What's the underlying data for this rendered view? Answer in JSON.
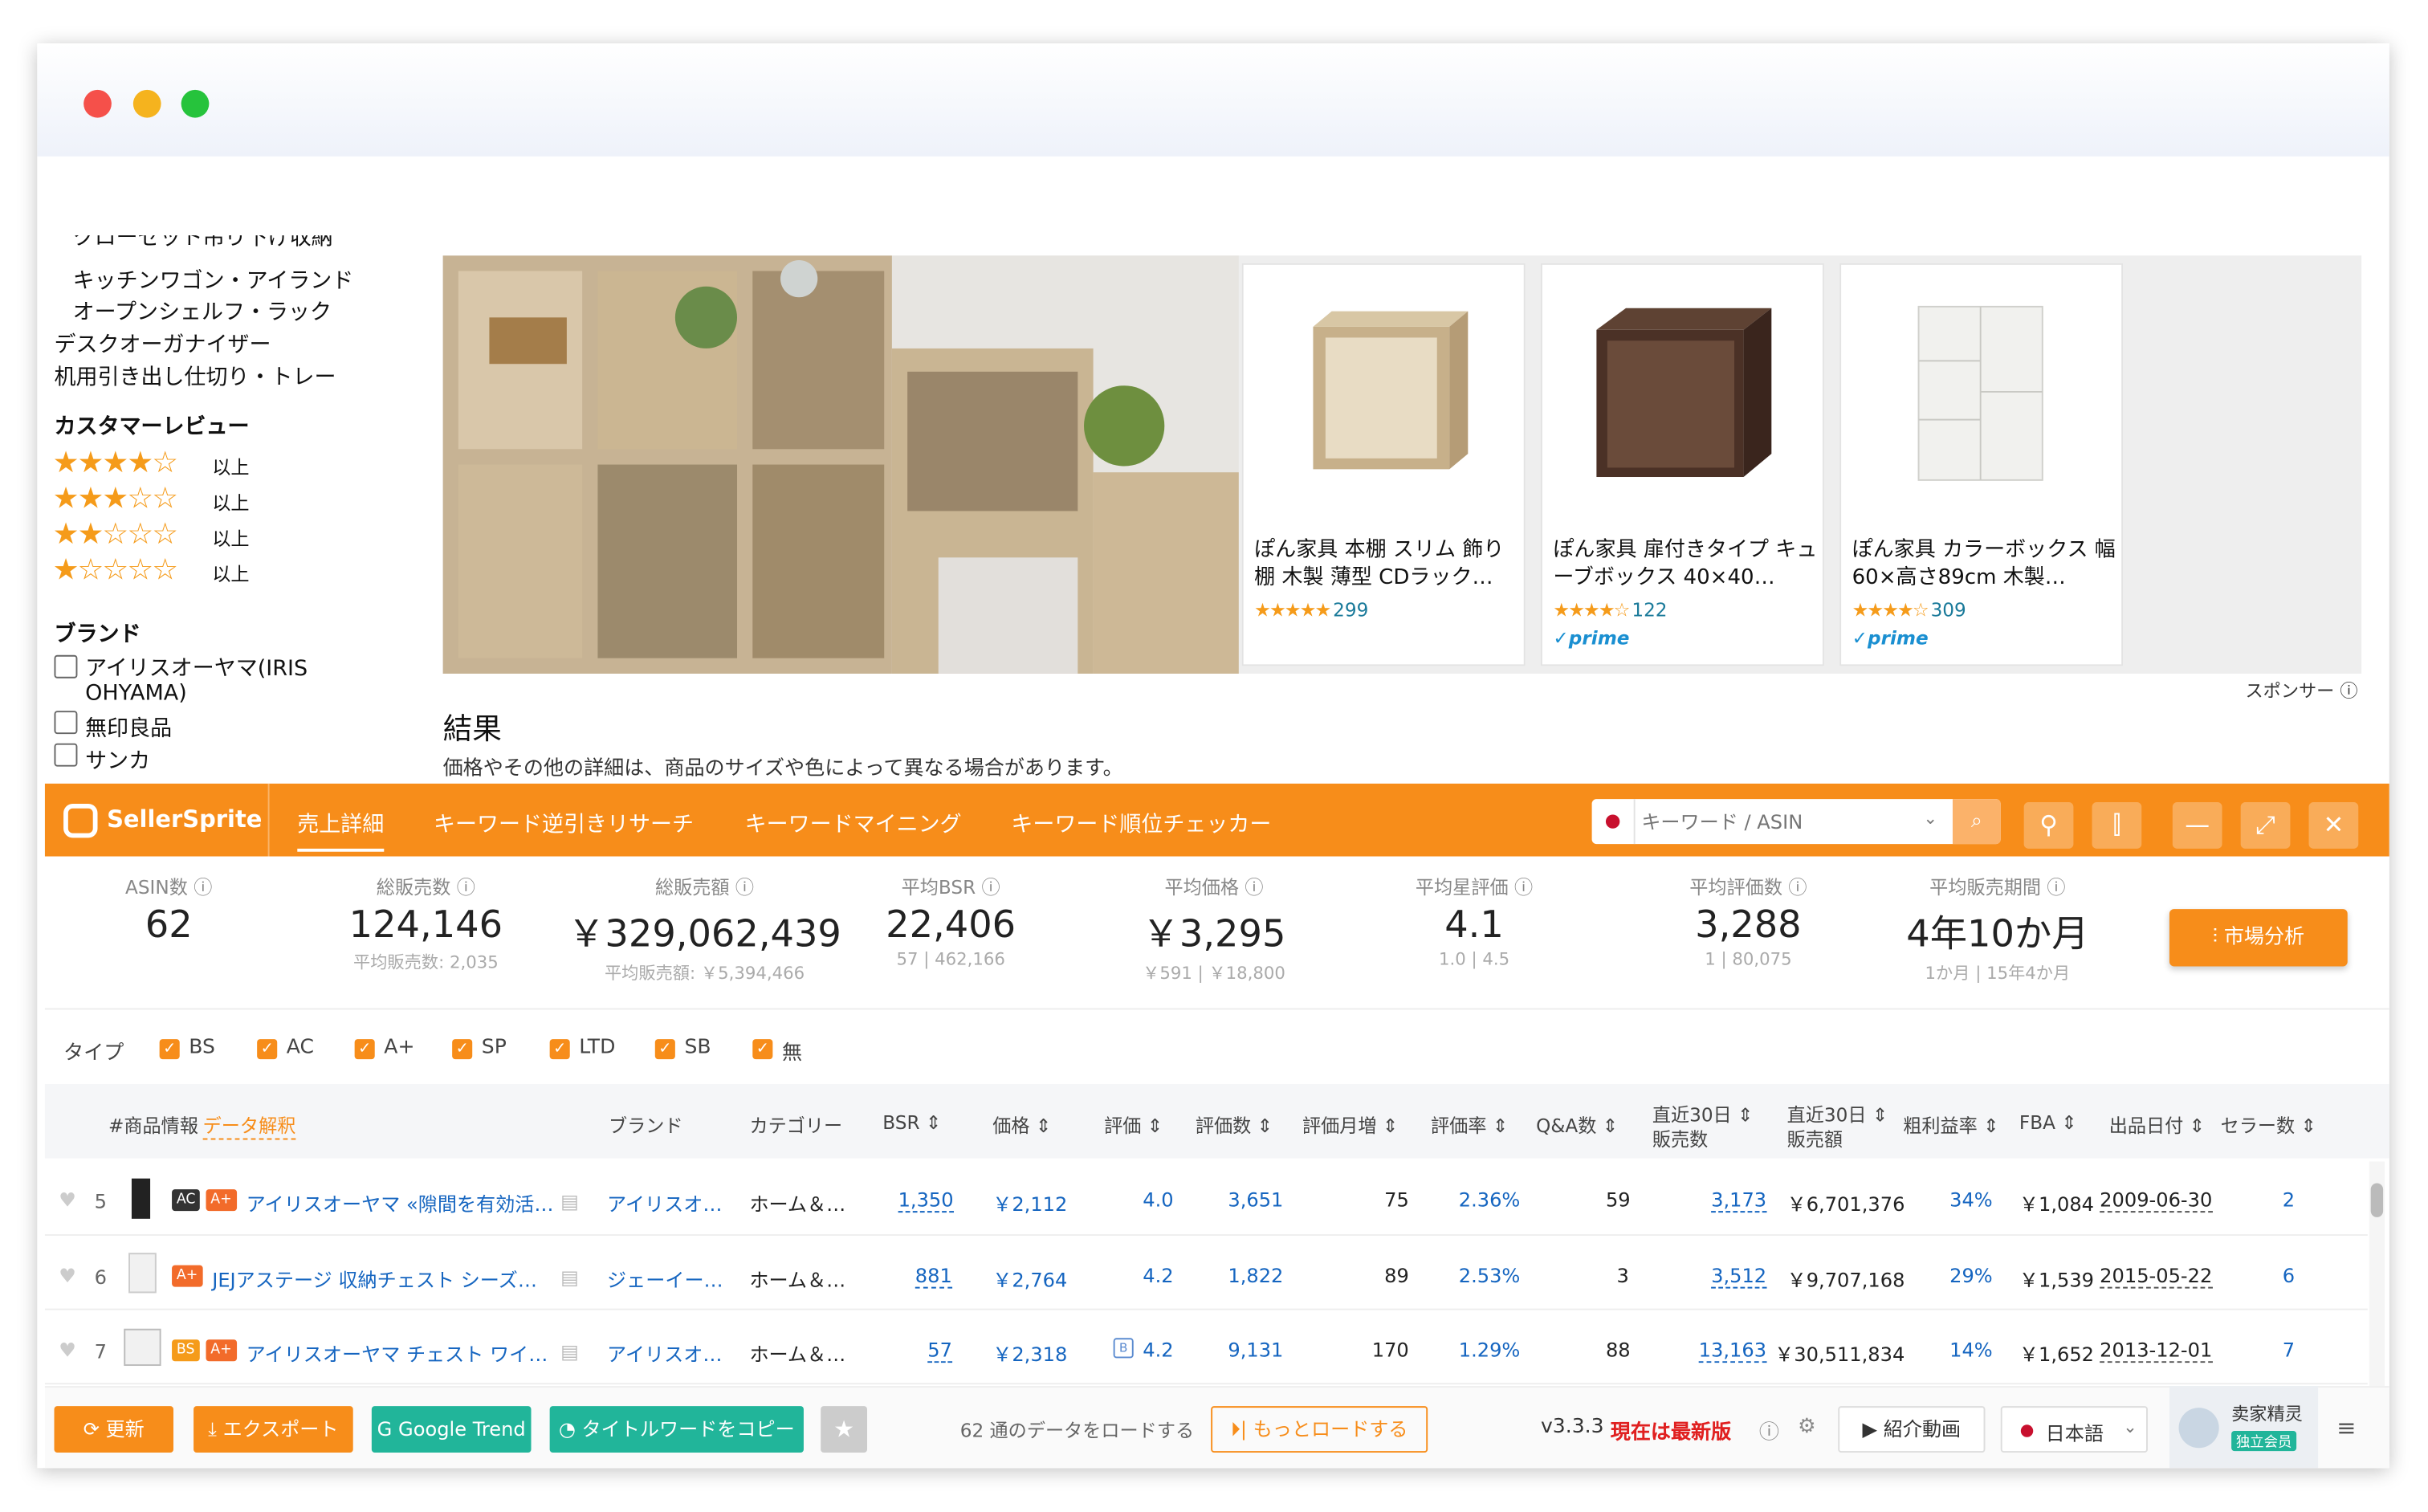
{
  "sidebar": {
    "cut_item": "クローゼット吊り下げ収納",
    "categories": [
      "キッチンワゴン・アイランド",
      "オープンシェルフ・ラック",
      "デスクオーガナイザー",
      "机用引き出し仕切り・トレー"
    ],
    "review_heading": "カスタマーレビュー",
    "review_rows": [
      {
        "stars": "★★★★☆",
        "label": "以上"
      },
      {
        "stars": "★★★☆☆",
        "label": "以上"
      },
      {
        "stars": "★★☆☆☆",
        "label": "以上"
      },
      {
        "stars": "★☆☆☆☆",
        "label": "以上"
      }
    ],
    "brand_heading": "ブランド",
    "brands": [
      "アイリスオーヤマ(IRIS OHYAMA)",
      "無印良品",
      "サンカ"
    ]
  },
  "sponsored": {
    "products": [
      {
        "title": "ぽん家具 本棚 スリム 飾り棚 木製 薄型 CDラック…",
        "stars": "★★★★★",
        "count": "299",
        "prime": ""
      },
      {
        "title": "ぽん家具 扉付きタイプ キューブボックス 40×40…",
        "stars": "★★★★☆",
        "count": "122",
        "prime": "✓prime"
      },
      {
        "title": "ぽん家具 カラーボックス 幅60×高さ89cm 木製…",
        "stars": "★★★★☆",
        "count": "309",
        "prime": "✓prime"
      }
    ],
    "sponsor_label": "スポンサー ⓘ"
  },
  "results": {
    "heading": "結果",
    "note": "価格やその他の詳細は、商品のサイズや色によって異なる場合があります。"
  },
  "toolbar": {
    "brand": "SellerSprite",
    "tabs": [
      "売上詳細",
      "キーワード逆引きリサーチ",
      "キーワードマイニング",
      "キーワード順位チェッカー"
    ],
    "search_placeholder": "キーワード / ASIN"
  },
  "stats": [
    {
      "label": "ASIN数 ⓘ",
      "value": "62",
      "sub": ""
    },
    {
      "label": "総販売数 ⓘ",
      "value": "124,146",
      "sub": "平均販売数: 2,035"
    },
    {
      "label": "総販売額 ⓘ",
      "value": "￥329,062,439",
      "sub": "平均販売額: ￥5,394,466"
    },
    {
      "label": "平均BSR ⓘ",
      "value": "22,406",
      "sub": "57 | 462,166"
    },
    {
      "label": "平均価格 ⓘ",
      "value": "￥3,295",
      "sub": "￥591 | ￥18,800"
    },
    {
      "label": "平均星評価 ⓘ",
      "value": "4.1",
      "sub": "1.0 | 4.5"
    },
    {
      "label": "平均評価数 ⓘ",
      "value": "3,288",
      "sub": "1 | 80,075"
    },
    {
      "label": "平均販売期間 ⓘ",
      "value": "4年10か月",
      "sub": "1か月 | 15年4か月"
    }
  ],
  "market_button": "市場分析",
  "types": {
    "label": "タイプ",
    "items": [
      "BS",
      "AC",
      "A+",
      "SP",
      "LTD",
      "SB",
      "無"
    ]
  },
  "headers": {
    "product": "#商品情報",
    "data_link": "データ解釈",
    "brand": "ブランド",
    "category": "カテゴリー",
    "bsr": "BSR ⇕",
    "price": "価格 ⇕",
    "rating": "評価 ⇕",
    "reviews": "評価数 ⇕",
    "monthly_reviews": "評価月増 ⇕",
    "rating_rate": "評価率 ⇕",
    "qa": "Q&A数 ⇕",
    "sales30_1": "直近30日 ⇕",
    "sales30_2": "販売数",
    "rev30_1": "直近30日 ⇕",
    "rev30_2": "販売額",
    "margin": "粗利益率 ⇕",
    "fba": "FBA ⇕",
    "date": "出品日付 ⇕",
    "sellers": "セラー数 ⇕"
  },
  "rows": [
    {
      "num": "5",
      "badges": [
        "AC",
        "A+"
      ],
      "title": "アイリスオーヤマ «隙間を有効活…",
      "brand": "アイリスオ…",
      "category": "ホーム＆…",
      "bsr": "1,350",
      "price": "￥2,112",
      "rating": "4.0",
      "reviews": "3,651",
      "monthly": "75",
      "rate": "2.36%",
      "qa": "59",
      "sales": "3,173",
      "revenue": "￥6,701,376",
      "margin": "34%",
      "fba": "￥1,084",
      "date": "2009-06-30",
      "sellers": "2"
    },
    {
      "num": "6",
      "badges": [
        "A+"
      ],
      "title": "JEJアステージ 収納チェスト シーズ…",
      "brand": "ジェーイー…",
      "category": "ホーム＆…",
      "bsr": "881",
      "price": "￥2,764",
      "rating": "4.2",
      "reviews": "1,822",
      "monthly": "89",
      "rate": "2.53%",
      "qa": "3",
      "sales": "3,512",
      "revenue": "￥9,707,168",
      "margin": "29%",
      "fba": "￥1,539",
      "date": "2015-05-22",
      "sellers": "6"
    },
    {
      "num": "7",
      "badges": [
        "BS",
        "A+"
      ],
      "title": "アイリスオーヤマ チェスト ワイ…",
      "brand": "アイリスオ…",
      "category": "ホーム＆…",
      "bsr": "57",
      "price": "￥2,318",
      "rating": "4.2",
      "reviews": "9,131",
      "monthly": "170",
      "rate": "1.29%",
      "qa": "88",
      "sales": "13,163",
      "revenue": "￥30,511,834",
      "margin": "14%",
      "fba": "￥1,652",
      "date": "2013-12-01",
      "sellers": "7"
    }
  ],
  "footer": {
    "refresh": "⟳ 更新",
    "export": "⤓ エクスポート",
    "google": "G Google Trend",
    "copy": "◔ タイトルワードをコピー",
    "loaded": "62 通のデータをロードする",
    "load_more": "⏵| もっとロードする",
    "version": "v3.3.3",
    "latest": "現在は最新版",
    "video": "▶ 紹介動画",
    "lang": "日本語",
    "account": "卖家精灵",
    "member": "独立会员"
  }
}
